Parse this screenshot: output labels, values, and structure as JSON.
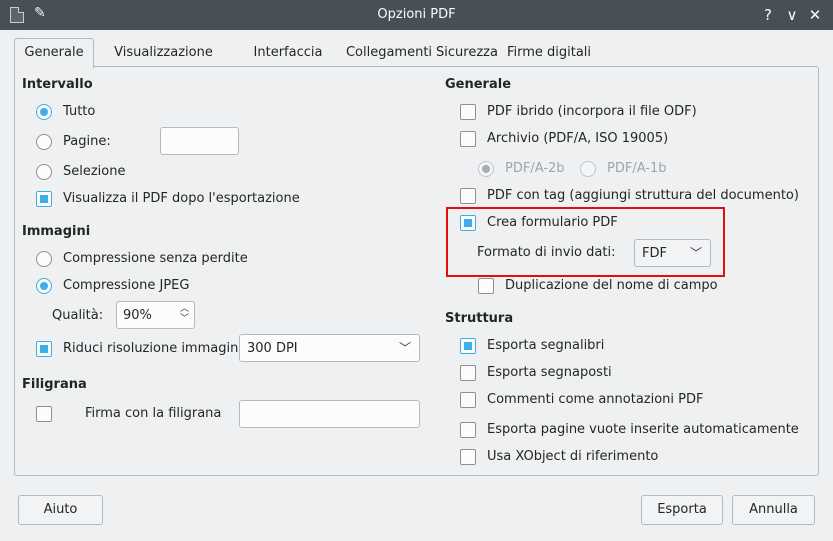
{
  "window": {
    "title": "Opzioni PDF",
    "help_glyph": "?",
    "minimize_glyph": "∨",
    "close_glyph": "✕"
  },
  "tabs": [
    {
      "label": "Generale"
    },
    {
      "label": "Visualizzazione iniziale"
    },
    {
      "label": "Interfaccia utente"
    },
    {
      "label": "Collegamenti"
    },
    {
      "label": "Sicurezza"
    },
    {
      "label": "Firme digitali"
    }
  ],
  "range": {
    "title": "Intervallo",
    "all": "Tutto",
    "pages": "Pagine:",
    "pages_value": "",
    "selection": "Selezione",
    "view_pdf": "Visualizza il PDF dopo l'esportazione"
  },
  "images": {
    "title": "Immagini",
    "lossless": "Compressione senza perdite",
    "jpeg": "Compressione JPEG",
    "quality_label": "Qualità:",
    "quality_value": "90%",
    "reduce_resolution": "Riduci risoluzione immagine",
    "resolution_value": "300 DPI"
  },
  "watermark": {
    "title": "Filigrana",
    "sign": "Firma con la filigrana",
    "value": ""
  },
  "general": {
    "title": "Generale",
    "hybrid": "PDF ibrido (incorpora il file ODF)",
    "archive": "Archivio (PDF/A, ISO 19005)",
    "pdfa2b": "PDF/A-2b",
    "pdfa1b": "PDF/A-1b",
    "tagged": "PDF con tag (aggiungi struttura del documento)",
    "create_form": "Crea formulario PDF",
    "submit_format_label": "Formato di invio dati:",
    "submit_format_value": "FDF",
    "duplicate_names": "Duplicazione del nome di campo"
  },
  "structure": {
    "title": "Struttura",
    "bookmarks": "Esporta segnalibri",
    "placeholders": "Esporta segnaposti",
    "comments": "Commenti come annotazioni PDF",
    "blank_pages": "Esporta pagine vuote inserite automaticamente",
    "xobject": "Usa XObject di riferimento"
  },
  "footer": {
    "help": "Aiuto",
    "export": "Esporta",
    "cancel": "Annulla"
  },
  "colors": {
    "accent": "#3daee9",
    "titlebar": "#475057",
    "highlight": "#dd1111"
  }
}
